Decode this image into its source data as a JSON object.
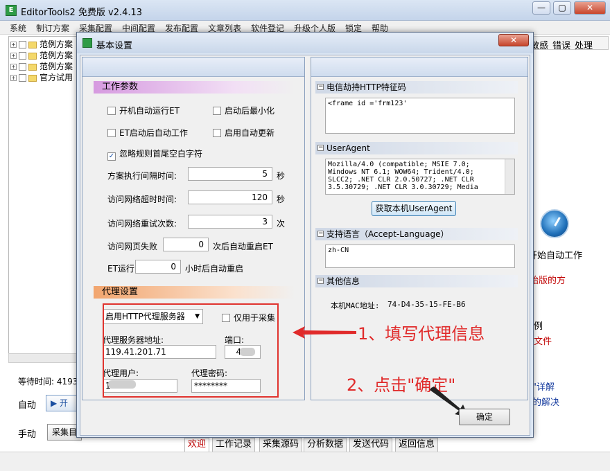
{
  "main": {
    "title": "EditorTools2 免费版 v2.4.13",
    "buttons": {
      "minimize": "—",
      "restore": "▢",
      "close": "✕"
    },
    "menu": [
      "系统",
      "制订方案",
      "采集配置",
      "中间配置",
      "发布配置",
      "文章列表",
      "软件登记",
      "升级个人版",
      "锁定",
      "帮助"
    ],
    "tree": [
      {
        "expander": "+",
        "label": "范例方案"
      },
      {
        "expander": "+",
        "label": "范例方案"
      },
      {
        "expander": "+",
        "label": "范例方案"
      },
      {
        "expander": "+",
        "label": "官方试用"
      }
    ],
    "columns": [
      "敏感",
      "错误",
      "处理"
    ],
    "right_texts": [
      "开始自动工作",
      "始版的方",
      "例",
      "文件",
      "\"详解",
      "的解决"
    ],
    "waiting_label": "等待时间:",
    "waiting_value": "4193",
    "auto_label": "自动",
    "auto_button": "▶ 开",
    "manual_label": "手动",
    "collect_button": "采集目",
    "bottom_tabs": [
      "欢迎",
      "工作记录",
      "采集源码",
      "分析数据",
      "发送代码",
      "返回信息"
    ]
  },
  "dialog": {
    "title": "基本设置",
    "close": "✕",
    "work_params": {
      "header": "工作参数",
      "auto_run": {
        "label": "开机自动运行ET",
        "checked": false
      },
      "minimize_after": {
        "label": "启动后最小化",
        "checked": false
      },
      "auto_work": {
        "label": "ET启动后自动工作",
        "checked": false
      },
      "auto_update": {
        "label": "启用自动更新",
        "checked": false
      },
      "ignore_whitespace": {
        "label": "忽略规则首尾空白字符",
        "checked": true,
        "mark": "✓"
      },
      "interval_label": "方案执行间隔时间:",
      "interval_value": "5",
      "interval_unit": "秒",
      "timeout_label": "访问网络超时时间:",
      "timeout_value": "120",
      "timeout_unit": "秒",
      "retry_label": "访问网络重试次数:",
      "retry_value": "3",
      "retry_unit": "次",
      "fail_label": "访问网页失败",
      "fail_value": "0",
      "fail_suffix": "次后自动重启ET",
      "et_run_label": "ET运行",
      "et_run_value": "0",
      "et_run_suffix": "小时后自动重启"
    },
    "proxy": {
      "header": "代理设置",
      "mode": "启用HTTP代理服务器",
      "collect_only": {
        "label": "仅用于采集",
        "checked": false
      },
      "server_label": "代理服务器地址:",
      "server_value": "119.41.201.71",
      "port_label": "端口:",
      "port_value": "4   9",
      "user_label": "代理用户:",
      "user_value": "1      3",
      "password_label": "代理密码:",
      "password_value": "********"
    },
    "right": {
      "telecom_header": "电信劫持HTTP特征码",
      "telecom_value": "<frame id ='frm123'",
      "ua_header": "UserAgent",
      "ua_value": "Mozilla/4.0 (compatible; MSIE 7.0;\nWindows NT 6.1; WOW64; Trident/4.0;\nSLCC2; .NET CLR 2.0.50727; .NET CLR\n3.5.30729; .NET CLR 3.0.30729; Media",
      "get_ua_button": "获取本机UserAgent",
      "lang_header": "支持语言（Accept-Language）",
      "lang_value": "zh-CN",
      "other_header": "其他信息",
      "mac_label": "本机MAC地址:",
      "mac_value": "74-D4-35-15-FE-B6"
    },
    "ok_button": "确定"
  },
  "annotations": {
    "step1": "1、填写代理信息",
    "step2": "2、点击\"确定\""
  },
  "colors": {
    "annotation_red": "#e02a2a",
    "section_purple": "#d69ae0",
    "section_orange": "#f2a56e"
  }
}
